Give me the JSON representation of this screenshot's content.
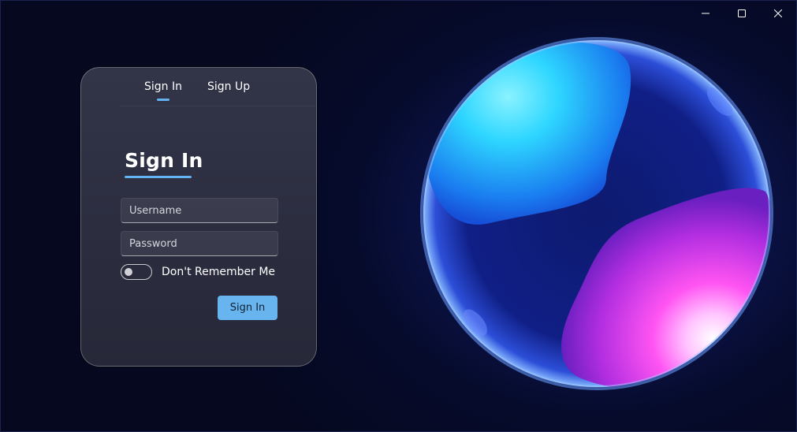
{
  "window": {
    "controls": [
      {
        "icon": "minimize-icon"
      },
      {
        "icon": "maximize-icon"
      },
      {
        "icon": "close-icon"
      }
    ]
  },
  "auth_card": {
    "tabs": [
      {
        "label": "Sign In",
        "active": true
      },
      {
        "label": "Sign Up",
        "active": false
      }
    ],
    "heading": "Sign In",
    "username_placeholder": "Username",
    "password_placeholder": "Password",
    "remember_toggle": {
      "label": "Don't Remember Me",
      "on": false
    },
    "submit_label": "Sign In"
  },
  "colors": {
    "accent": "#62b2f4",
    "button": "#67b4ef",
    "background": "#05081e"
  },
  "artwork": {
    "icon": "glowing-sphere-artwork"
  }
}
